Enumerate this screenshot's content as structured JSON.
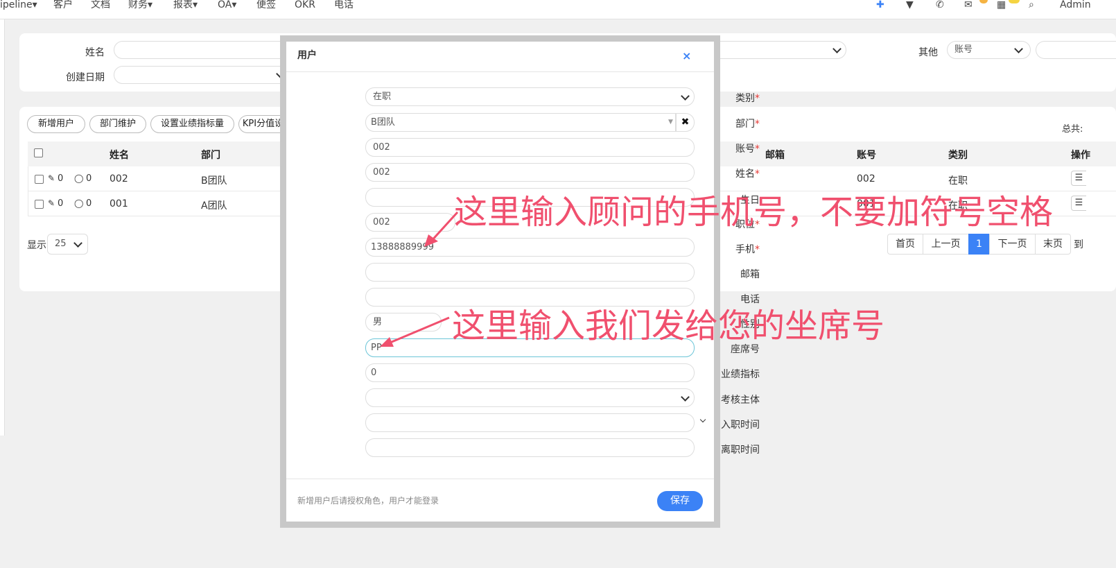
{
  "topnav": {
    "items": [
      "ipeline▾",
      "客户",
      "文档",
      "财务▾",
      "报表▾",
      "OA▾",
      "便签",
      "OKR",
      "电话"
    ],
    "user": "Admin"
  },
  "filter": {
    "name_label": "姓名",
    "created_label": "创建日期",
    "other_label": "其他",
    "other_select": "账号"
  },
  "toolbar": {
    "buttons": [
      "新增用户",
      "部门维护",
      "设置业绩指标量",
      "KPI分值设"
    ],
    "total_label": "总共:"
  },
  "table": {
    "headers": {
      "name": "姓名",
      "dept": "部门",
      "email": "邮箱",
      "account": "账号",
      "category": "类别",
      "actions": "操作"
    },
    "rows": [
      {
        "attach": "0",
        "comments": "0",
        "name": "002",
        "dept": "B团队",
        "account": "002",
        "category": "在职"
      },
      {
        "attach": "0",
        "comments": "0",
        "name": "001",
        "dept": "A团队",
        "account": "001",
        "category": "在职"
      }
    ]
  },
  "pagination": {
    "show_label": "显示",
    "page_size": "25",
    "first": "首页",
    "prev": "上一页",
    "current": "1",
    "next": "下一页",
    "last": "末页",
    "goto": "到"
  },
  "modal": {
    "title": "用户",
    "fields": {
      "category": {
        "label": "类别",
        "value": "在职"
      },
      "dept": {
        "label": "部门",
        "value": "B团队"
      },
      "account": {
        "label": "账号",
        "value": "002"
      },
      "name": {
        "label": "姓名",
        "value": "002"
      },
      "birthday": {
        "label": "生日",
        "value": ""
      },
      "position": {
        "label": "职位",
        "value": "002"
      },
      "mobile": {
        "label": "手机",
        "value": "13888889999"
      },
      "email": {
        "label": "邮箱",
        "value": ""
      },
      "phone": {
        "label": "电话",
        "value": ""
      },
      "gender": {
        "label": "性别",
        "value": "男"
      },
      "seat": {
        "label": "座席号",
        "value": "PP"
      },
      "target": {
        "label": "业绩指标",
        "value": "0"
      },
      "assess": {
        "label": "考核主体",
        "value": ""
      },
      "join_date": {
        "label": "入职时间",
        "value": ""
      },
      "leave_date": {
        "label": "离职时间",
        "value": ""
      }
    },
    "footer_note": "新增用户后请授权角色，用户才能登录",
    "save_label": "保存"
  },
  "annotations": {
    "mobile_hint": "这里输入顾问的手机号，不要加符号空格",
    "seat_hint": "这里输入我们发给您的坐席号"
  },
  "colors": {
    "accent": "#3b82f6",
    "annotation": "#f0506e"
  }
}
